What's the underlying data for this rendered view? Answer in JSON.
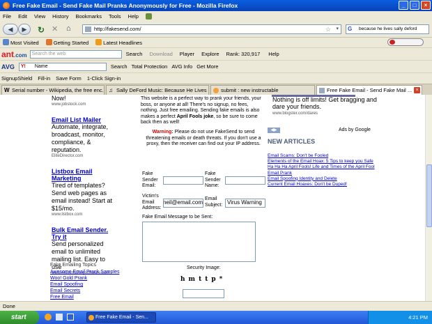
{
  "window": {
    "title": "Free Fake Email - Send Fake Mail Pranks Anonymously for Free - Mozilla Firefox"
  },
  "menu": [
    "File",
    "Edit",
    "View",
    "History",
    "Bookmarks",
    "Tools",
    "Help"
  ],
  "nav": {
    "url": "http://fakesend.com/",
    "search_value": "because he lives sally deford"
  },
  "bookmarks": [
    "Most Visited",
    "Getting Started",
    "Latest Headlines"
  ],
  "ant_toolbar": {
    "logo_main": "ant",
    "logo_suffix": ".com",
    "search_placeholder": "Search the web",
    "search": "Search",
    "download": "Download",
    "player": "Player",
    "explore": "Explore",
    "rank": "Rank: 320,917",
    "help": "Help"
  },
  "avg_toolbar": {
    "logo": "AVG",
    "name_field": "Name",
    "search": "Search",
    "total_protection": "Total Protection",
    "avg_info": "AVG Info",
    "get_more": "Get More"
  },
  "signup_toolbar": {
    "signupshield": "SignupShield",
    "fill_in": "Fill-in",
    "save_form": "Save Form",
    "one_click": "1-Click Sign-in"
  },
  "tabs": [
    {
      "label": "Serial number - Wikipedia, the free enc..."
    },
    {
      "label": "Sally DeFord Music: Because He Lives"
    },
    {
      "label": "submit : new instructable"
    },
    {
      "label": "Free Fake Email - Send Fake Mail ..."
    }
  ],
  "left_ads": {
    "top_text": "Now!",
    "top_url": "www.jobstock.com",
    "ads": [
      {
        "title": "Email List Mailer",
        "body": "Automate, integrate, broadcast, monitor, compliance, & reputation.",
        "url": "EliteDirector.com"
      },
      {
        "title": "Listbox Email Marketing",
        "body": "Tired of templates? Send web pages as email instead! Start at $15/mo.",
        "url": "www.listbox.com"
      },
      {
        "title": "Bulk Email Sender. Try it",
        "body": "Send personalized email to unlimited mailing list. Easy to use",
        "url": "www.massmailingsoftware.com"
      }
    ],
    "topics_header": "Fake Emailing Topics",
    "topics": [
      "Awesome Email Prank Samples",
      "Woo! Gold Prank",
      "Email Spoofing",
      "Email Secrets",
      "Free Email"
    ]
  },
  "main": {
    "intro": "This website is a perfect way to prank your friends, your boss, or anyone at all! There's no signup, no fees, nothing. Just free emailing. Sending fake emails is also makes a perfect ",
    "intro_bold": "April Fools joke",
    "intro_end": ", so be sure to come back then as well!",
    "warning_label": "Warning:",
    "warning_text": " Please do not use FakeSend to send threatening emails or death threats. If you don't use a proxy, then the receiver can find out your IP address.",
    "form": {
      "sender_email_label": "Fake Sender Email:",
      "sender_name_label": "Fake Sender Name:",
      "victim_label": "Victim's Email Address:",
      "victim_value": "neil@email.com",
      "subject_label": "Email Subject:",
      "subject_value": "Virus Warning",
      "message_label": "Fake Email Message to be Sent:",
      "security_label": "Security Image:",
      "captcha": "hmttp*"
    }
  },
  "right": {
    "top_text": "Nothing is off limits! Get bragging and dare your friends.",
    "top_url": "www.blogster.com/dares",
    "ads_by": "Ads by Google",
    "new_articles": "NEW ARTICLES",
    "articles": [
      "Email Scams: Don't be Fooled",
      "Elements of the Email Hoax: 5 Tips to keep you Safe",
      "Ha Ha Ha April Fools! Life and Times of the April Fool",
      "Email Prank",
      "Email Spoofing Identity and Delete",
      "Current Email Hoaxes: Don't be Duped!"
    ]
  },
  "status": "Done",
  "taskbar": {
    "start": "start",
    "task": "Free Fake Email - Sen...",
    "clock": "4:21 PM"
  }
}
